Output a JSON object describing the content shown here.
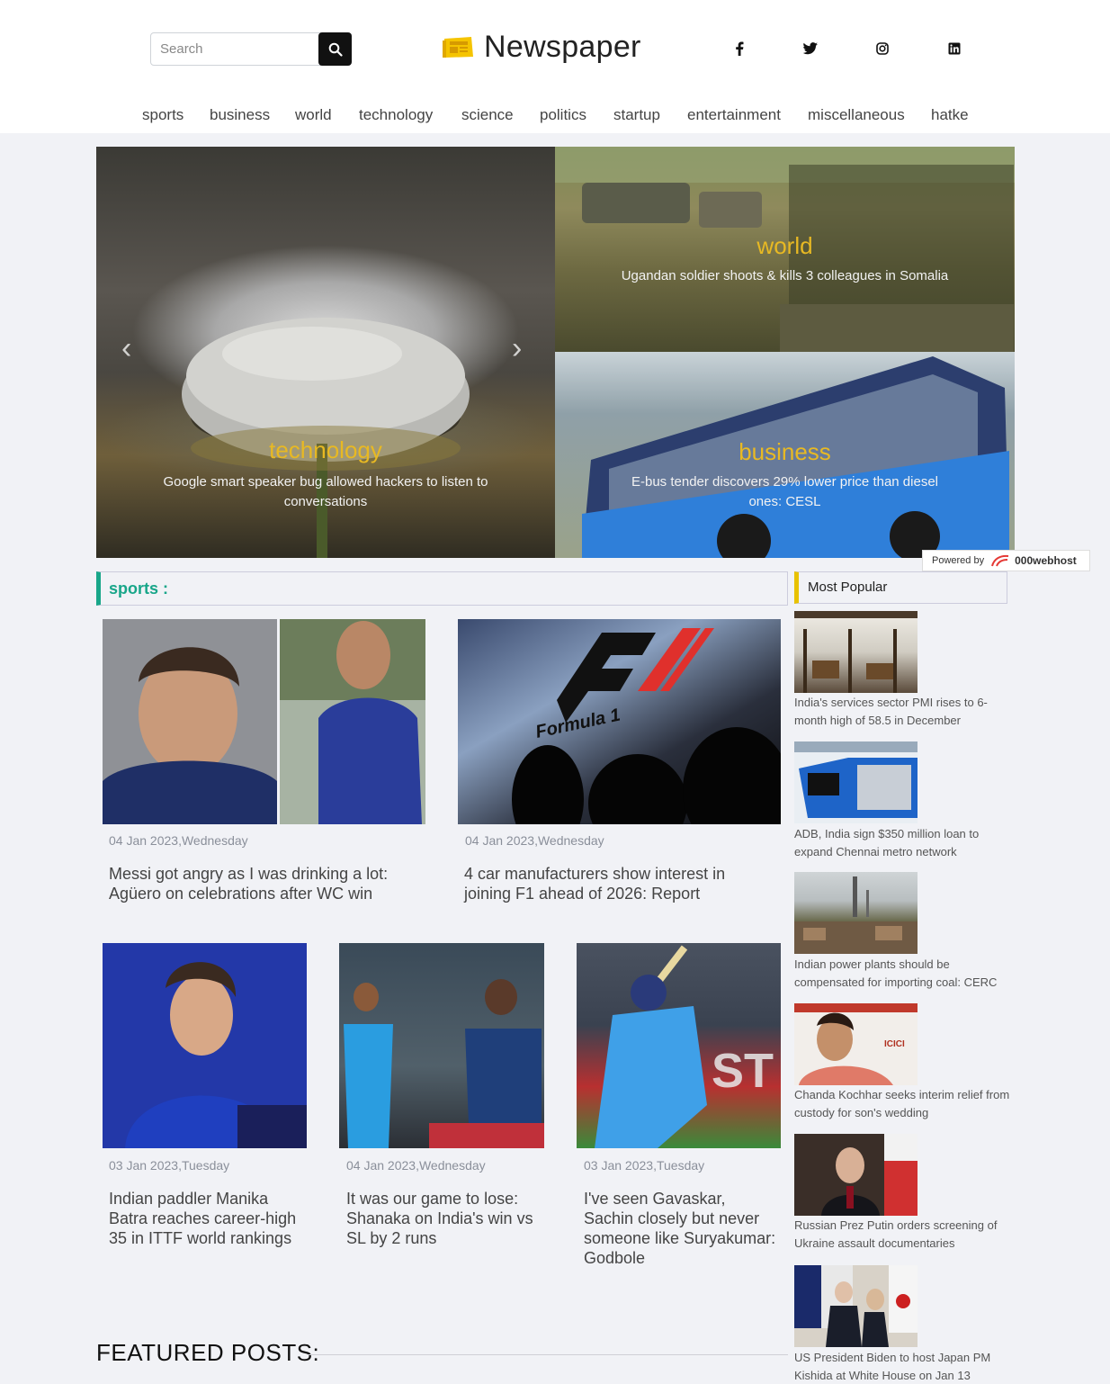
{
  "header": {
    "search_placeholder": "Search",
    "logo_text": "Newspaper",
    "social": [
      "facebook-icon",
      "twitter-icon",
      "instagram-icon",
      "linkedin-icon"
    ]
  },
  "nav": [
    "sports",
    "business",
    "world",
    "technology",
    "science",
    "politics",
    "startup",
    "entertainment",
    "miscellaneous",
    "hatke"
  ],
  "hero": {
    "main": {
      "category": "technology",
      "title": "Google smart speaker bug allowed hackers to listen to conversations"
    },
    "top": {
      "category": "world",
      "title": "Ugandan soldier shoots & kills 3 colleagues in Somalia"
    },
    "bottom": {
      "category": "business",
      "title": "E-bus tender discovers 29% lower price than diesel ones: CESL"
    }
  },
  "powered": {
    "label": "Powered by",
    "brand": "000webhost"
  },
  "sports": {
    "heading": "sports :",
    "articles": [
      {
        "date": "04 Jan 2023,Wednesday",
        "title": "Messi got angry as I was drinking a lot: Agüero on celebrations after WC win"
      },
      {
        "date": "04 Jan 2023,Wednesday",
        "title": "4 car manufacturers show interest in joining F1 ahead of 2026: Report"
      },
      {
        "date": "03 Jan 2023,Tuesday",
        "title": "Indian paddler Manika Batra reaches career-high 35 in ITTF world rankings"
      },
      {
        "date": "04 Jan 2023,Wednesday",
        "title": "It was our game to lose: Shanaka on India's win vs SL by 2 runs"
      },
      {
        "date": "03 Jan 2023,Tuesday",
        "title": "I've seen Gavaskar, Sachin closely but never someone like Suryakumar: Godbole"
      }
    ]
  },
  "popular": {
    "heading": "Most Popular",
    "items": [
      "India's services sector PMI rises to 6-month high of 58.5 in December",
      "ADB, India sign $350 million loan to expand Chennai metro network",
      "Indian power plants should be compensated for importing coal: CERC",
      "Chanda Kochhar seeks interim relief from custody for son's wedding",
      "Russian Prez Putin orders screening of Ukraine assault documentaries",
      "US President Biden to host Japan PM Kishida at White House on Jan 13"
    ]
  },
  "image_text": {
    "f1_logo": "Formula 1"
  },
  "featured": {
    "heading": "FEATURED POSTS:"
  },
  "colors": {
    "accent_green": "#18a689",
    "accent_yellow": "#e8c200",
    "hero_category": "#e8b923"
  }
}
